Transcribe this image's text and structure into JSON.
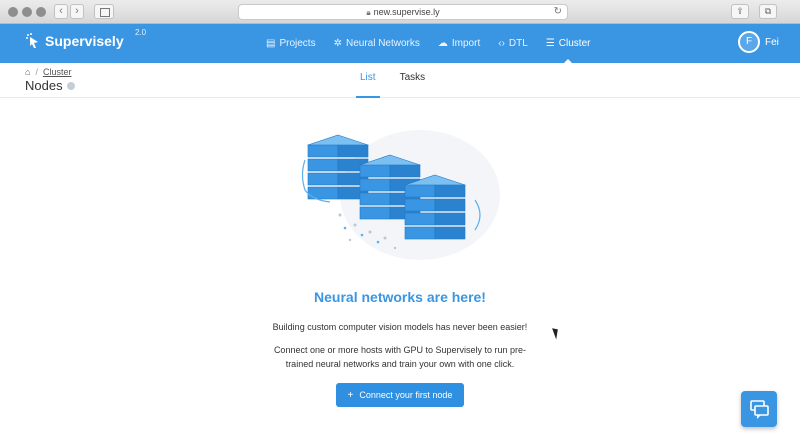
{
  "browser": {
    "url": "new.supervise.ly"
  },
  "app": {
    "brand": "Supervisely",
    "version": "2.0",
    "nav": [
      {
        "label": "Projects",
        "icon": "projects-icon"
      },
      {
        "label": "Neural Networks",
        "icon": "neural-networks-icon"
      },
      {
        "label": "Import",
        "icon": "cloud-upload-icon"
      },
      {
        "label": "DTL",
        "icon": "code-icon"
      },
      {
        "label": "Cluster",
        "icon": "list-icon",
        "active": true
      }
    ],
    "user": {
      "initial": "F",
      "name": "Fei"
    },
    "accent_color": "#3a96e3"
  },
  "subheader": {
    "breadcrumb": "Cluster",
    "title": "Nodes",
    "tabs": [
      {
        "label": "List",
        "active": true
      },
      {
        "label": "Tasks",
        "active": false
      }
    ]
  },
  "main": {
    "title": "Neural networks are here!",
    "subtitle": "Building custom computer vision models has never been easier!",
    "description": "Connect one or more hosts with GPU to Supervisely to run pre-trained neural networks and train your own with one click.",
    "cta_label": "Connect your first node"
  }
}
